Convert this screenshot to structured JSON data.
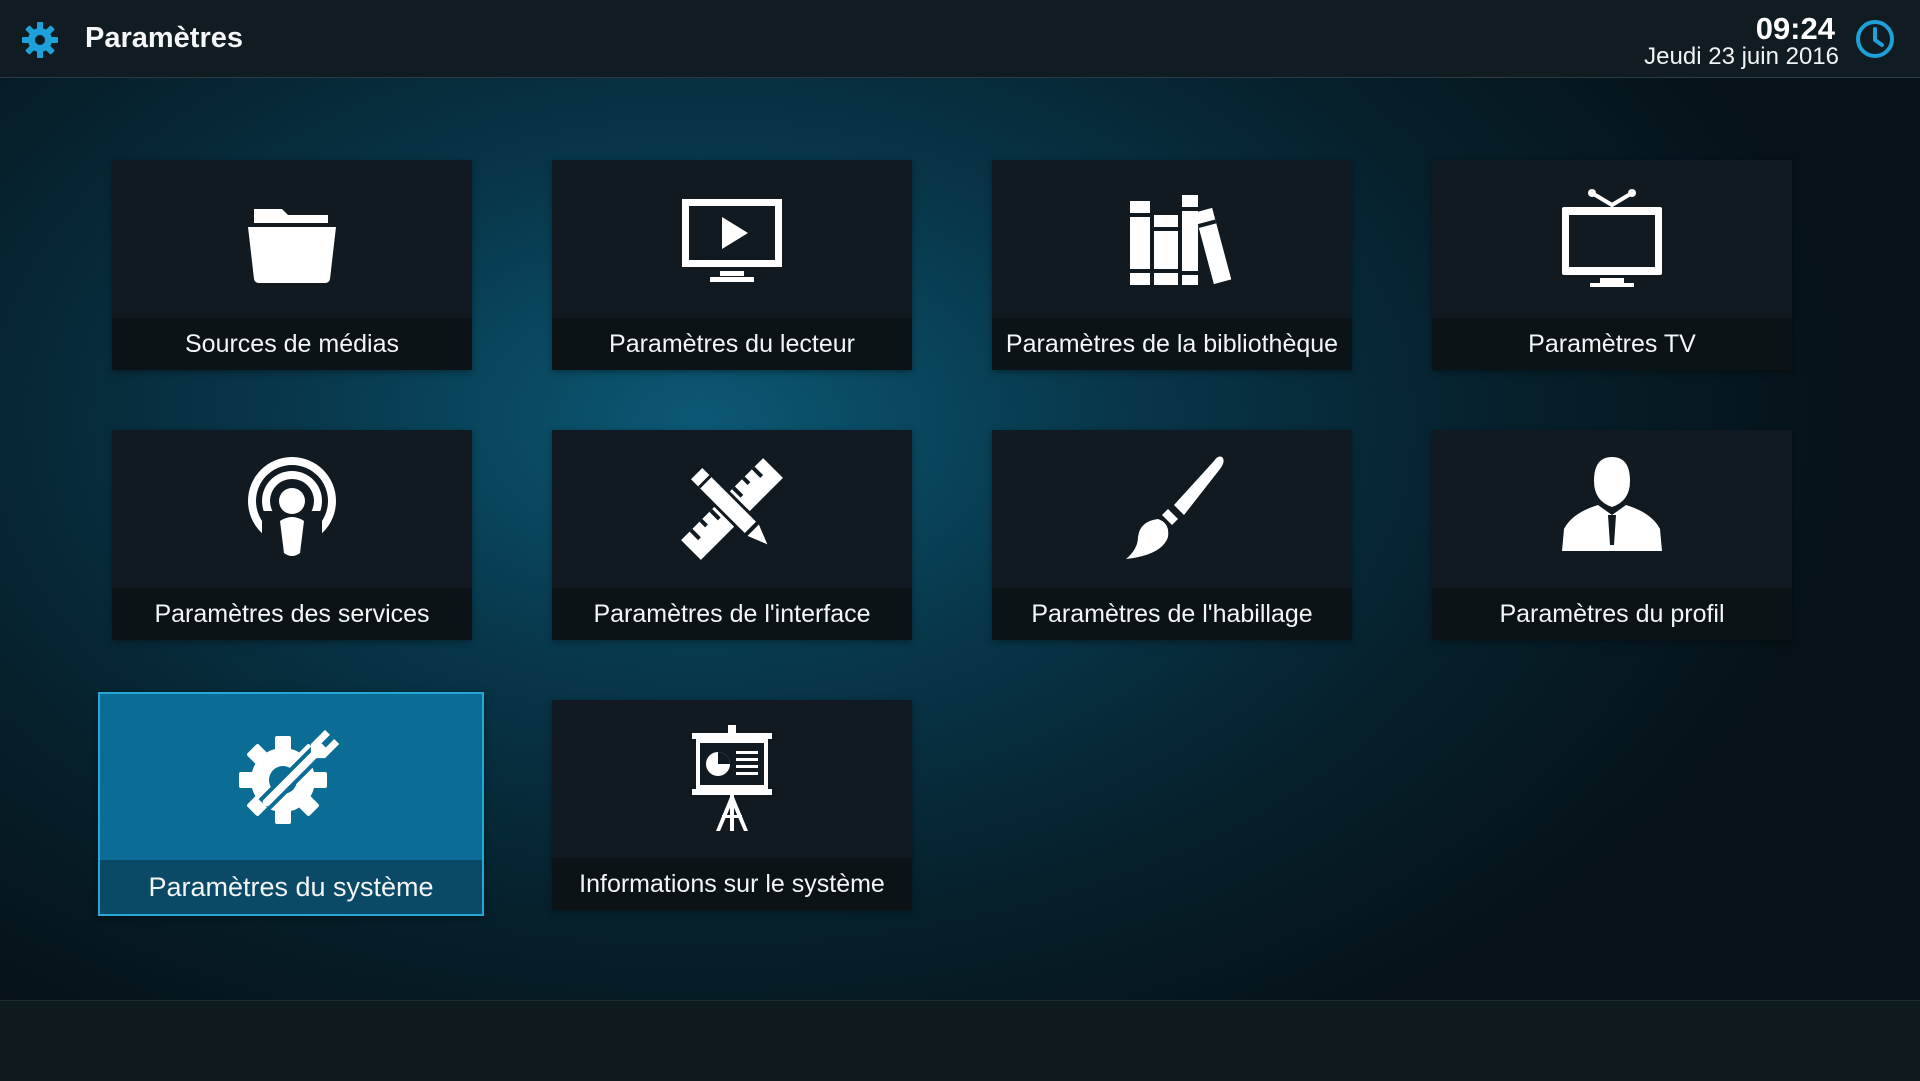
{
  "header": {
    "title": "Paramètres",
    "time": "09:24",
    "date": "Jeudi 23 juin 2016",
    "app_icon": "gear-icon",
    "clock_icon": "clock-icon"
  },
  "colors": {
    "accent": "#1ea0d8",
    "focus_tile": "#0b6d95",
    "tile": "#101a20",
    "topbar": "#111c22"
  },
  "tiles": [
    {
      "label": "Sources de médias",
      "icon": "folder-icon"
    },
    {
      "label": "Paramètres du lecteur",
      "icon": "player-monitor-icon"
    },
    {
      "label": "Paramètres de la bibliothèque",
      "icon": "library-books-icon"
    },
    {
      "label": "Paramètres TV",
      "icon": "tv-icon"
    },
    {
      "label": "Paramètres des services",
      "icon": "podcast-broadcast-icon"
    },
    {
      "label": "Paramètres de l'interface",
      "icon": "pencil-ruler-icon"
    },
    {
      "label": "Paramètres de l'habillage",
      "icon": "paintbrush-icon"
    },
    {
      "label": "Paramètres du profil",
      "icon": "user-profile-icon"
    },
    {
      "label": "Paramètres du système",
      "icon": "gear-wrench-icon",
      "focused": true
    },
    {
      "label": "Informations sur le système",
      "icon": "presentation-board-icon"
    }
  ]
}
